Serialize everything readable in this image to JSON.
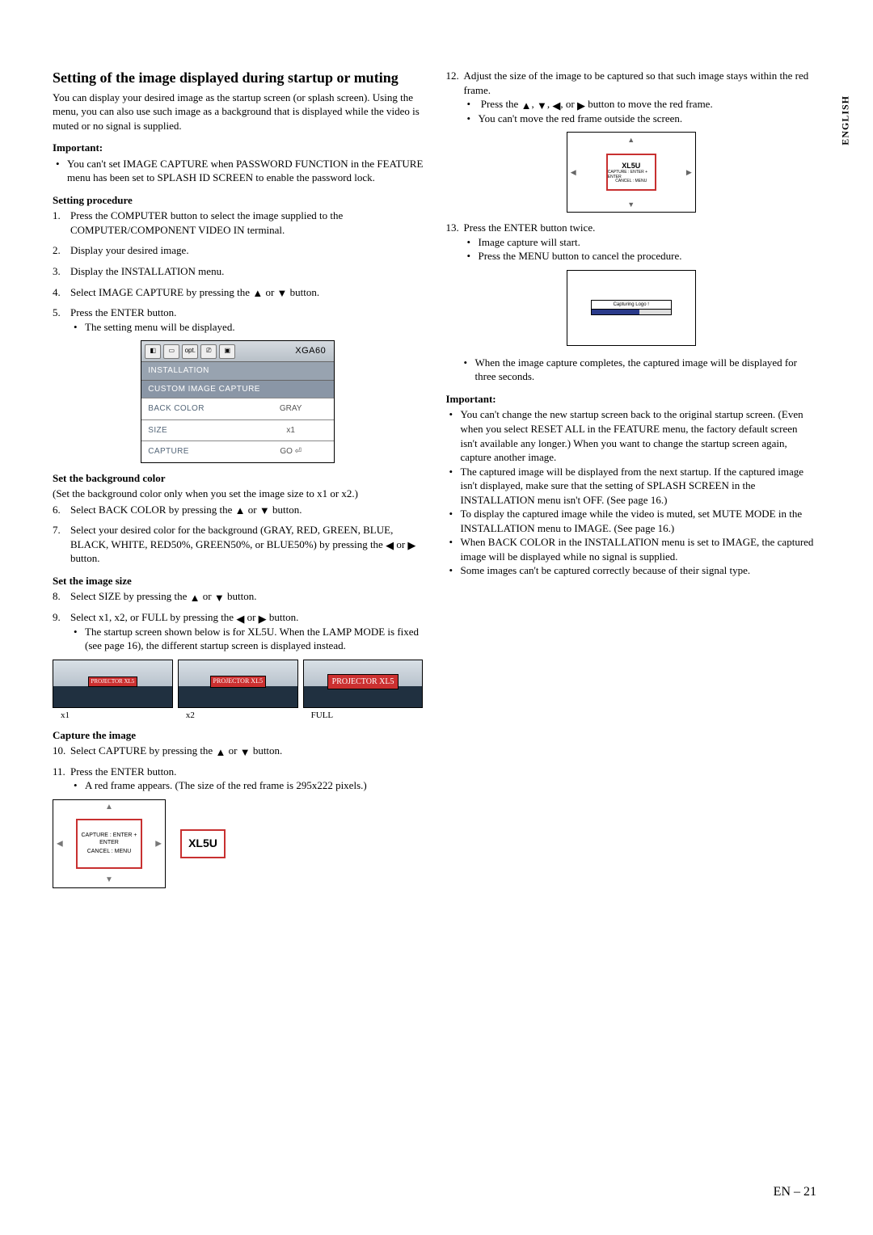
{
  "side_label": "ENGLISH",
  "page_number": "EN – 21",
  "left": {
    "title": "Setting of the image displayed during startup or muting",
    "intro": "You can display your desired image as the startup screen (or splash screen). Using the menu, you can also use such image as a background that is displayed while the video is muted or no signal is supplied.",
    "important_label": "Important:",
    "important_item": "You can't set IMAGE CAPTURE when PASSWORD FUNCTION in the FEATURE menu has been set to SPLASH ID SCREEN to enable the password lock.",
    "procedure_label": "Setting procedure",
    "steps": {
      "s1": "Press the COMPUTER button to select the image supplied to the COMPUTER/COMPONENT VIDEO IN terminal.",
      "s2": "Display your desired image.",
      "s3": "Display the INSTALLATION menu.",
      "s4_pre": "Select IMAGE CAPTURE by pressing the ",
      "s4_mid": " or ",
      "s4_post": " button.",
      "s5": "Press the ENTER button.",
      "s5_sub": "The setting menu will be displayed.",
      "s6_pre": "Select BACK COLOR by pressing the ",
      "s6_mid": " or ",
      "s6_post": " button.",
      "s7_pre": "Select your desired color for the background (GRAY, RED, GREEN, BLUE, BLACK, WHITE, RED50%, GREEN50%, or BLUE50%) by pressing the ",
      "s7_mid": " or ",
      "s7_post": " button.",
      "s8_pre": "Select SIZE by pressing the ",
      "s8_mid": " or ",
      "s8_post": " button.",
      "s9_pre": "Select x1, x2, or FULL by pressing the ",
      "s9_mid": " or ",
      "s9_post": " button.",
      "s9_sub": "The startup screen shown below is for XL5U. When the LAMP MODE is fixed (see page 16), the different startup screen is displayed instead.",
      "s10_pre": "Select CAPTURE by pressing the ",
      "s10_mid": " or ",
      "s10_post": " button.",
      "s11": "Press the ENTER button.",
      "s11_sub": "A red frame appears. (The size of the red frame is 295x222 pixels.)"
    },
    "bg_label": "Set the background color",
    "bg_note": "(Set the background color only when you set the image size to x1 or x2.)",
    "size_label": "Set the image size",
    "capture_label": "Capture the image",
    "menu": {
      "mode": "XGA60",
      "opt": "opt.",
      "bar1": "INSTALLATION",
      "bar2": "CUSTOM IMAGE CAPTURE",
      "r1k": "BACK COLOR",
      "r1v": "GRAY",
      "r2k": "SIZE",
      "r2v": "x1",
      "r3k": "CAPTURE",
      "r3v": "GO ⏎"
    },
    "thumb_logo1": "PROJECTOR XL5",
    "thumb_logo2": "PROJECTOR XL5",
    "thumb_logo3": "PROJECTOR XL5",
    "thumb_l1": "x1",
    "thumb_l2": "x2",
    "thumb_l3": "FULL",
    "frame_line1": "CAPTURE : ENTER + ENTER",
    "frame_line2": "CANCEL : MENU",
    "xl5u": "XL5U"
  },
  "right": {
    "s12_lead": "Adjust the size of the image to be captured so that such image stays within the red frame.",
    "s12_b1_pre": "Press the ",
    "s12_b1_mid": ", ",
    "s12_b1_post": " button to move the red frame.",
    "s12_b2": "You can't move the red frame outside the screen.",
    "fig1_text": "XL5U",
    "fig1_tiny1": "CAPTURE : ENTER + ENTER",
    "fig1_tiny2": "CANCEL : MENU",
    "s13": "Press the ENTER button twice.",
    "s13_b1": "Image capture will start.",
    "s13_b2": "Press the MENU button to cancel the procedure.",
    "fig2_label": "Capturing Logo !",
    "s13_after": "When the image capture completes, the captured image will be displayed for three seconds.",
    "important_label": "Important:",
    "imp1": "You can't change the new startup screen back to the original startup screen. (Even when you select RESET ALL in the FEATURE menu, the factory default screen isn't available any longer.) When you want to change the startup screen again, capture another image.",
    "imp2": "The captured image will be displayed from the next startup. If the captured image isn't displayed, make sure that the setting of SPLASH SCREEN in the INSTALLATION menu isn't OFF. (See page 16.)",
    "imp3": "To display the captured image while the video is muted, set MUTE MODE in the INSTALLATION menu to IMAGE. (See page 16.)",
    "imp4": "When BACK COLOR in the INSTALLATION menu is set to IMAGE, the captured image will be displayed while no signal is supplied.",
    "imp5": "Some images can't be captured correctly because of their signal type."
  }
}
